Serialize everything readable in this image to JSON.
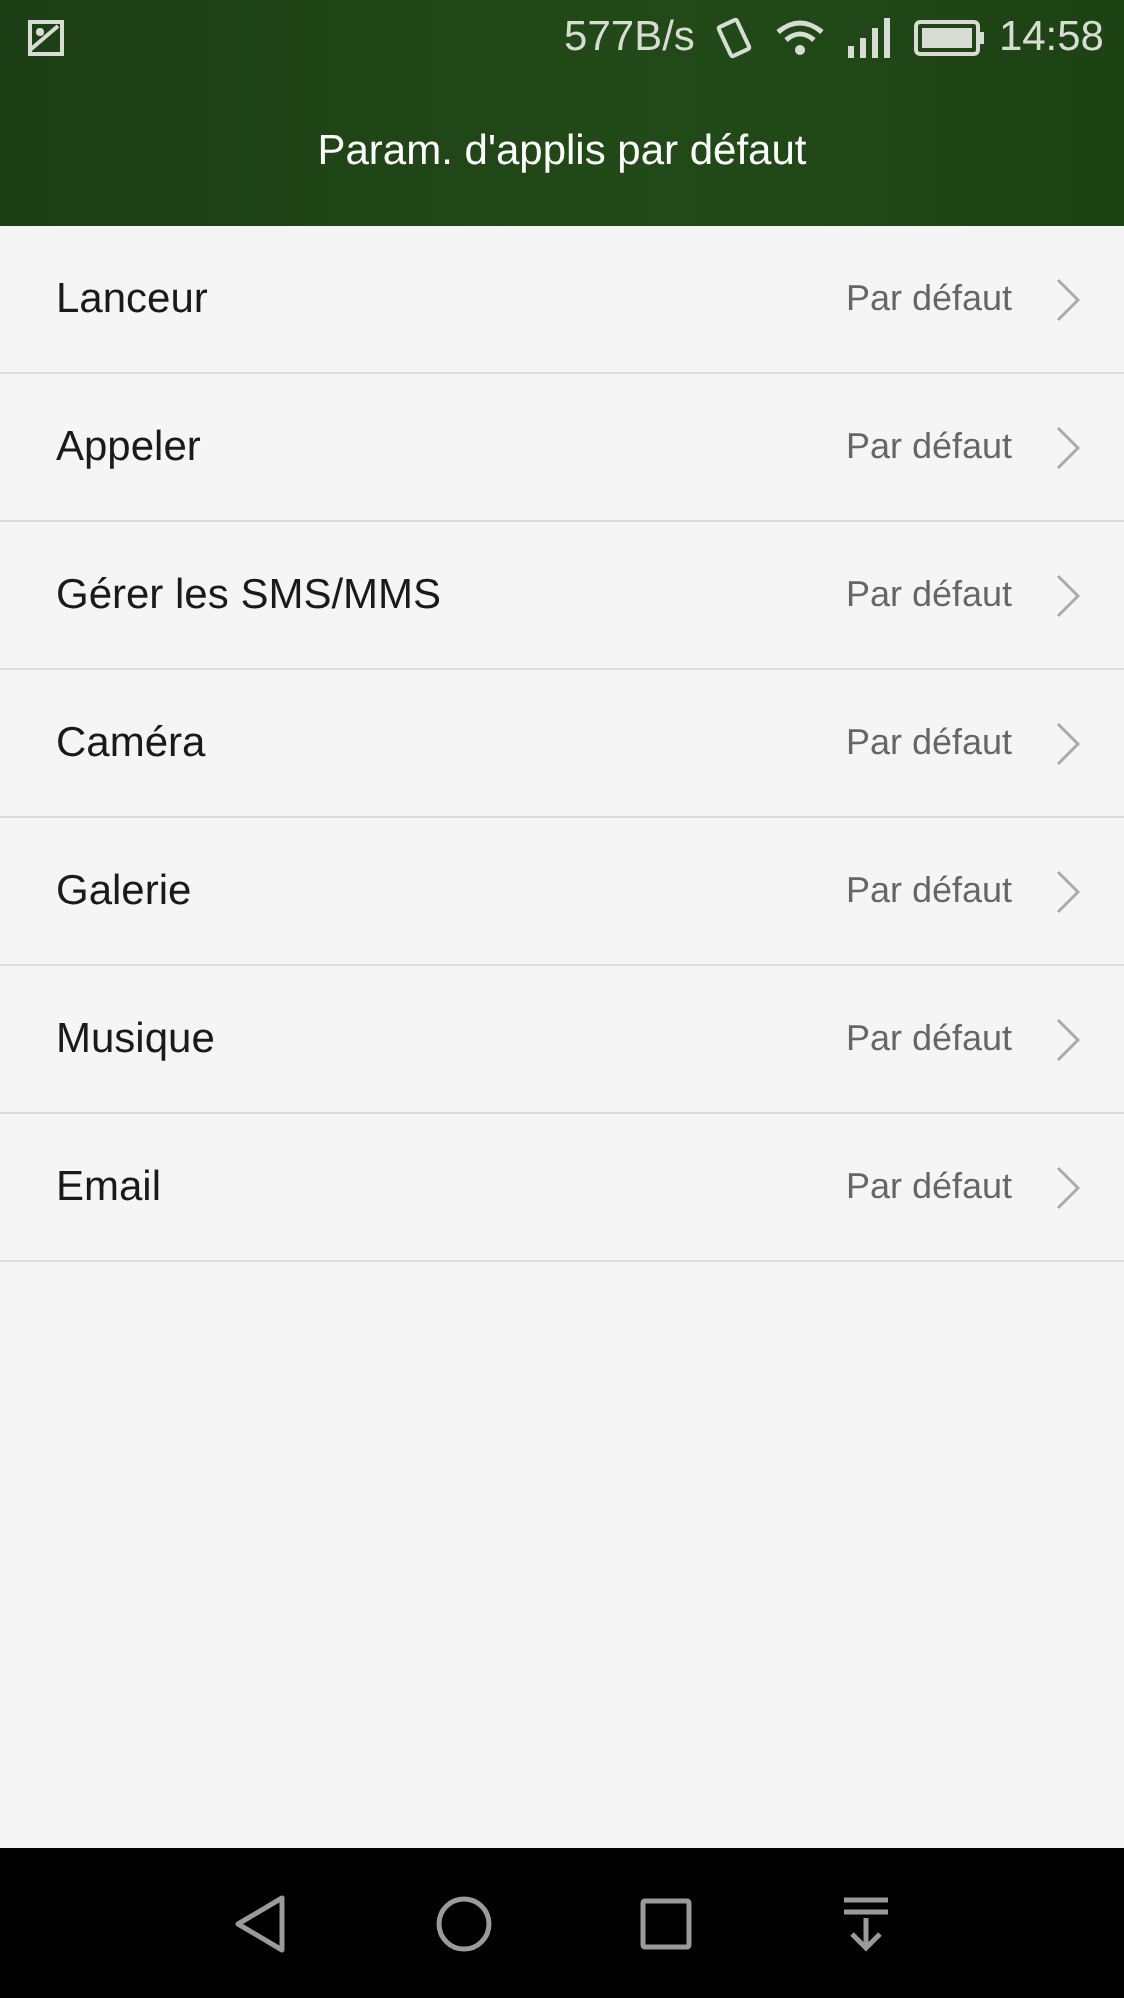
{
  "status_bar": {
    "speed": "577B/s",
    "time": "14:58"
  },
  "header": {
    "title": "Param. d'applis par défaut"
  },
  "items": [
    {
      "label": "Lanceur",
      "value": "Par défaut"
    },
    {
      "label": "Appeler",
      "value": "Par défaut"
    },
    {
      "label": "Gérer les SMS/MMS",
      "value": "Par défaut"
    },
    {
      "label": "Caméra",
      "value": "Par défaut"
    },
    {
      "label": "Galerie",
      "value": "Par défaut"
    },
    {
      "label": "Musique",
      "value": "Par défaut"
    },
    {
      "label": "Email",
      "value": "Par défaut"
    }
  ]
}
